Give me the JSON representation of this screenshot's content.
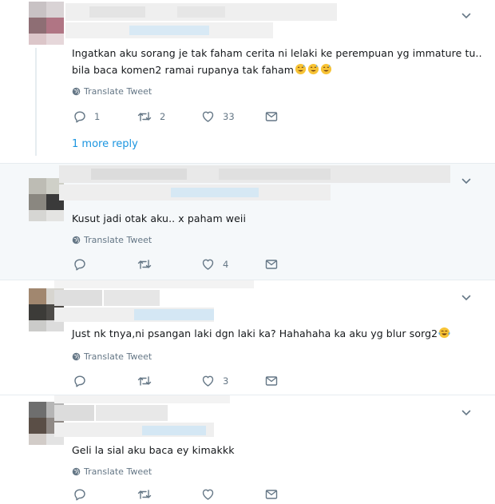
{
  "tweets": [
    {
      "text_lines": [
        "Ingatkan aku sorang je tak faham cerita ni lelaki ke perempuan yg immature tu..",
        "bila baca komen2 ramai rupanya tak faham"
      ],
      "trailing_emoji": [
        "sweat-smile-emoji",
        "sweat-smile-emoji",
        "sweat-smile-emoji"
      ],
      "translate_label": "Translate Tweet",
      "reply_count": "1",
      "retweet_count": "2",
      "like_count": "33",
      "more_replies_label": "1 more reply"
    },
    {
      "text": "Kusut jadi otak aku.. x paham weii",
      "translate_label": "Translate Tweet",
      "reply_count": "",
      "retweet_count": "",
      "like_count": "4"
    },
    {
      "text": "Just nk tnya,ni psangan laki dgn laki ka? Hahahaha ka aku yg blur sorg2",
      "trailing_emoji": [
        "joy-emoji"
      ],
      "translate_label": "Translate Tweet",
      "reply_count": "",
      "retweet_count": "",
      "like_count": "3"
    },
    {
      "text": "Geli la sial aku baca ey kimakkk",
      "translate_label": "Translate Tweet"
    }
  ],
  "colors": {
    "link": "#1b95e0",
    "muted": "#657786",
    "divider": "#e6ecf0",
    "hover_bg": "#f5f8fa"
  }
}
